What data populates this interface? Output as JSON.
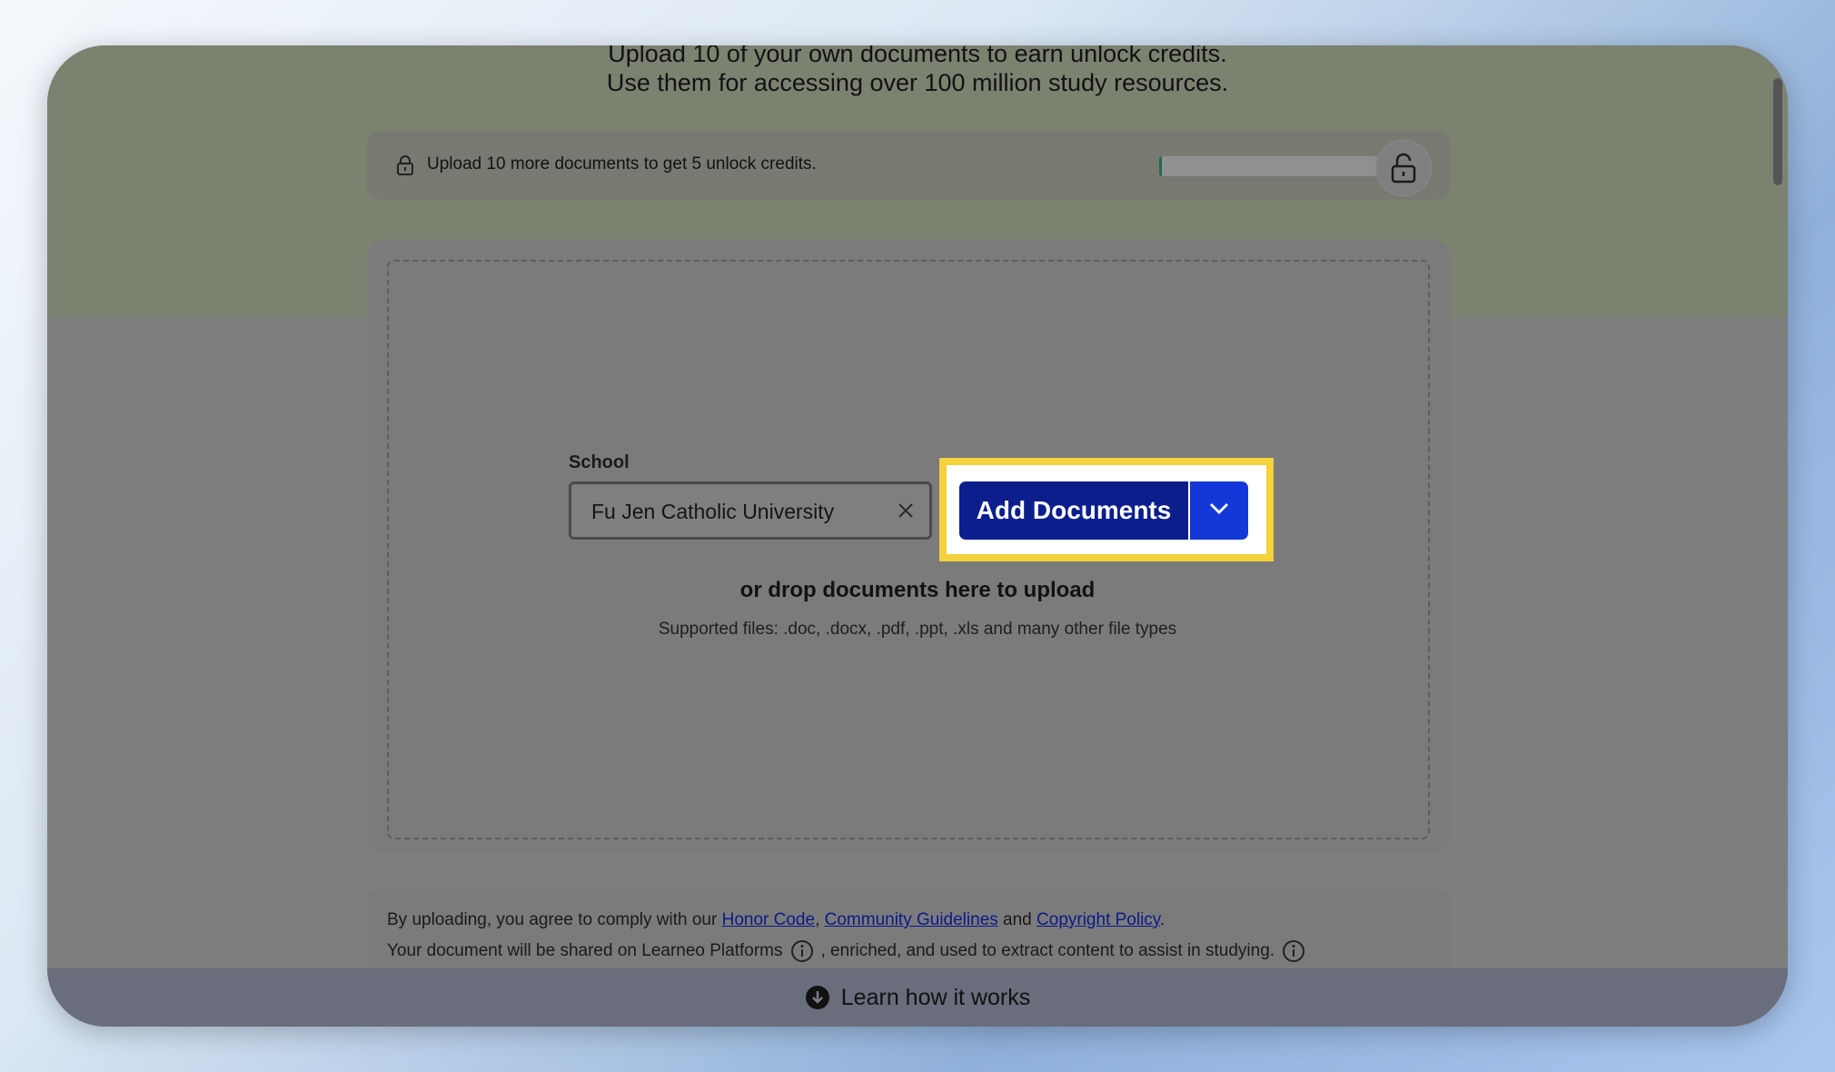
{
  "intro": {
    "line1": "Upload 10 of your own documents to earn unlock credits.",
    "line2": "Use them for accessing over 100 million study resources."
  },
  "credits": {
    "text": "Upload 10 more documents to get 5 unlock credits.",
    "progress_fraction": 0.0,
    "lock_icon": "lock-icon",
    "unlock_icon": "unlock-icon"
  },
  "upload": {
    "school_label": "School",
    "school_value": "Fu Jen Catholic University",
    "add_button_label": "Add Documents",
    "drop_text": "or drop documents here to upload",
    "supported_text": "Supported files: .doc, .docx, .pdf, .ppt, .xls and many other file types"
  },
  "terms": {
    "prefix": "By uploading, you agree to comply with our ",
    "honor_code": "Honor Code",
    "comma": ", ",
    "community_guidelines": "Community Guidelines",
    "and": " and ",
    "copyright_policy": "Copyright Policy",
    "period": ".",
    "shared_text": "Your document will be shared on Learneo Platforms",
    "enriched_text": ", enriched, and used to extract content to assist in studying."
  },
  "footer": {
    "learn_label": "Learn how it works"
  },
  "colors": {
    "primary_button": "#0b1e8c",
    "caret_button": "#1438d8",
    "highlight": "#f5d13a"
  }
}
